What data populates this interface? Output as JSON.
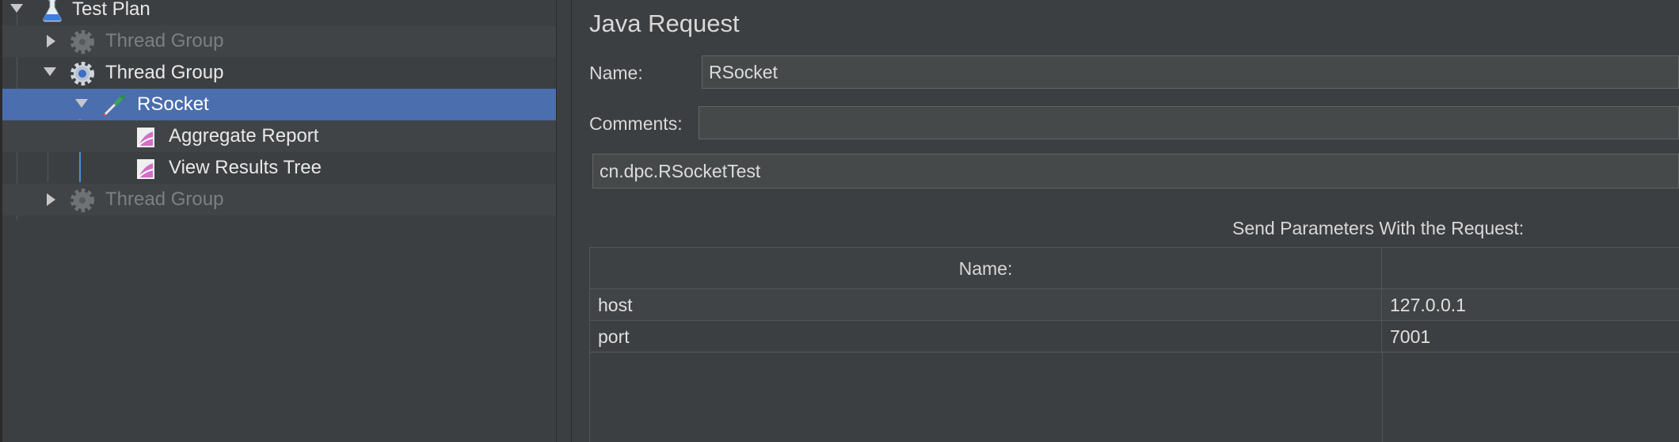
{
  "tree": {
    "items": [
      {
        "label": "Test Plan",
        "icon": "flask-icon",
        "expanded": true,
        "enabled": true
      },
      {
        "label": "Thread Group",
        "icon": "gear-icon",
        "expanded": false,
        "enabled": false
      },
      {
        "label": "Thread Group",
        "icon": "gear-icon",
        "expanded": true,
        "enabled": true
      },
      {
        "label": "RSocket",
        "icon": "pipette-icon",
        "expanded": true,
        "enabled": true,
        "selected": true
      },
      {
        "label": "Aggregate Report",
        "icon": "report-icon",
        "enabled": true
      },
      {
        "label": "View Results Tree",
        "icon": "report-icon",
        "enabled": true
      },
      {
        "label": "Thread Group",
        "icon": "gear-icon",
        "expanded": false,
        "enabled": false
      }
    ]
  },
  "panel": {
    "title": "Java Request",
    "name_label": "Name:",
    "name_value": "RSocket",
    "comments_label": "Comments:",
    "comments_value": "",
    "classname_value": "cn.dpc.RSocketTest",
    "send_params_label": "Send Parameters With the Request:",
    "table": {
      "columns": [
        "Name:",
        ""
      ],
      "rows": [
        {
          "name": "host",
          "value": "127.0.0.1"
        },
        {
          "name": "port",
          "value": "7001"
        }
      ]
    }
  },
  "colors": {
    "background": "#3c3f41",
    "selection": "#4b6eaf",
    "tree_line": "#4a8ed8"
  }
}
